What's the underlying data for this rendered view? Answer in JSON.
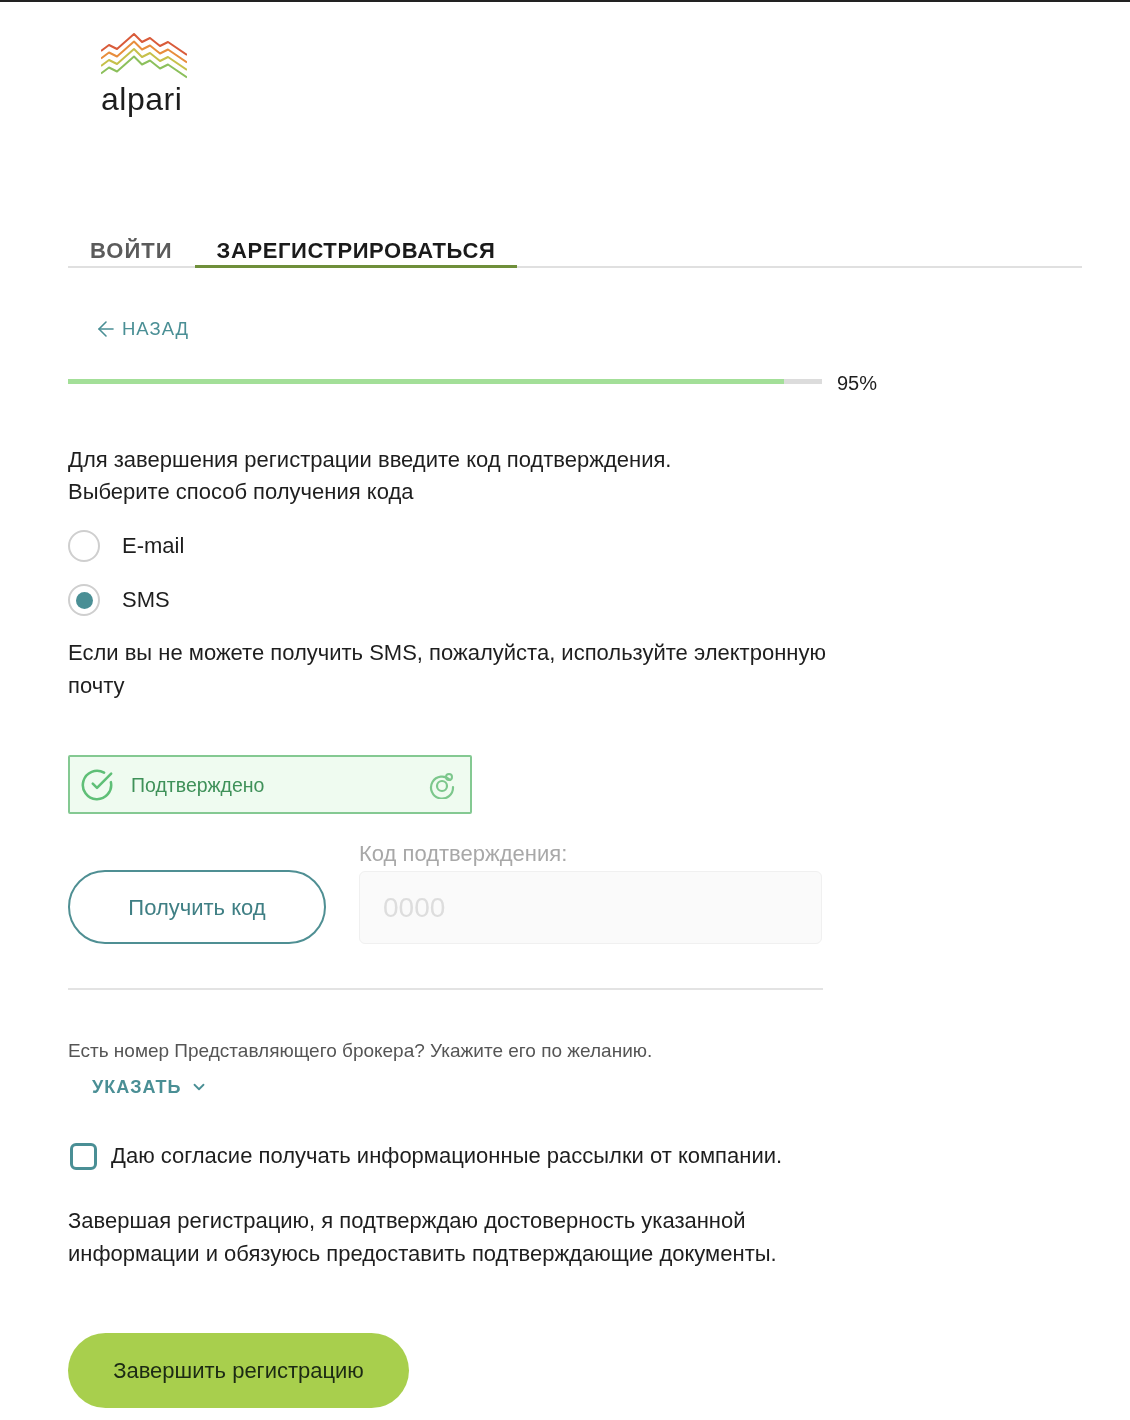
{
  "logo": {
    "wordmark": "alpari"
  },
  "tabs": [
    {
      "label": "ВОЙТИ",
      "selected": false
    },
    {
      "label": "ЗАРЕГИСТРИРОВАТЬСЯ",
      "selected": true
    }
  ],
  "back_link": {
    "label": "НАЗАД"
  },
  "progress": {
    "level": 0.95,
    "reading": "95%"
  },
  "instructions": [
    "Для завершения регистрации введите код подтверждения.",
    "Выберите способ получения кода"
  ],
  "methods": [
    {
      "label": "E-mail",
      "selected": false
    },
    {
      "label": "SMS",
      "selected": true
    }
  ],
  "sms_note": "Если вы не можете получить SMS, пожалуйста, используйте электронную почту",
  "captcha": {
    "label": "Подтверждено",
    "verified": true
  },
  "get_code_button": {
    "label": "Получить код"
  },
  "code_field": {
    "label": "Код подтверждения:",
    "placeholder": "0000",
    "disabled": true
  },
  "broker": {
    "prompt": "Есть номер Представляющего брокера? Укажите его по желанию.",
    "toggle": "УКАЗАТЬ",
    "expanded": false
  },
  "newsletter_consent": {
    "label": "Даю согласие получать информационные рассылки от компании.",
    "checked": false
  },
  "disclaimer": "Завершая регистрацию, я подтверждаю достоверность указанной информации и обязуюсь предоставить подтверждающие документы.",
  "submit_button": {
    "label": "Завершить регистрацию"
  }
}
